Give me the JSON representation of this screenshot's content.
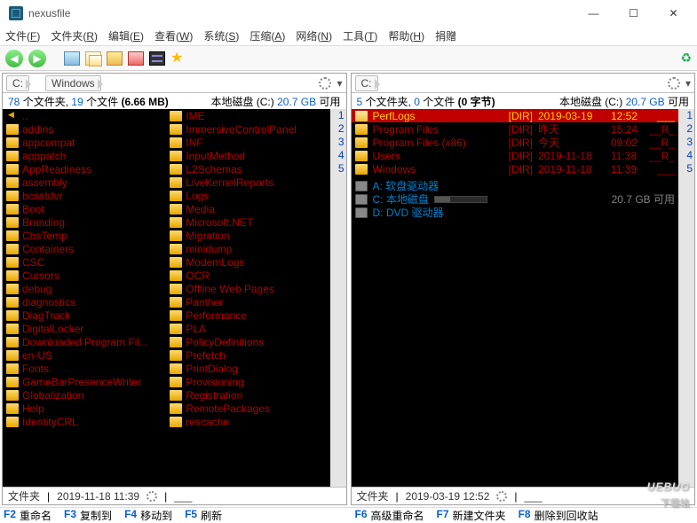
{
  "app": {
    "title": "nexusfile"
  },
  "winbtns": {
    "min": "—",
    "max": "☐",
    "close": "✕"
  },
  "menu": [
    "文件(<u>F</u>)",
    "文件夹(<u>R</u>)",
    "编辑(<u>E</u>)",
    "查看(<u>W</u>)",
    "系统(<u>S</u>)",
    "压缩(<u>A</u>)",
    "网络(<u>N</u>)",
    "工具(<u>T</u>)",
    "帮助(<u>H</u>)",
    "捐赠"
  ],
  "left": {
    "crumbs": [
      "C:",
      "Windows"
    ],
    "summary": {
      "folders_n": "78",
      "folders_lbl": "个文件夹,",
      "files_n": "19",
      "files_lbl": "个文件",
      "size": "(6.66 MB)",
      "drive_lbl": "本地磁盘 (C:)",
      "free_n": "20.7 GB",
      "free_lbl": "可用"
    },
    "colA": [
      "..",
      "addins",
      "appcompat",
      "apppatch",
      "AppReadiness",
      "assembly",
      "bcastdvr",
      "Boot",
      "Branding",
      "CbsTemp",
      "Containers",
      "CSC",
      "Cursors",
      "debug",
      "diagnostics",
      "DiagTrack",
      "DigitalLocker",
      "Downloaded Program Fil...",
      "en-US",
      "Fonts",
      "GameBarPresenceWriter",
      "Globalization",
      "Help",
      "IdentityCRL"
    ],
    "colB": [
      "IME",
      "ImmersiveControlPanel",
      "INF",
      "InputMethod",
      "L2Schemas",
      "LiveKernelReports",
      "Logs",
      "Media",
      "Microsoft.NET",
      "Migration",
      "minidump",
      "ModemLogs",
      "OCR",
      "Offline Web Pages",
      "Panther",
      "Performance",
      "PLA",
      "PolicyDefinitions",
      "Prefetch",
      "PrintDialog",
      "Provisioning",
      "Registration",
      "RemotePackages",
      "rescache"
    ],
    "status": {
      "type": "文件夹",
      "stamp": "2019-11-18 11:39",
      "attr": "___"
    }
  },
  "right": {
    "crumbs": [
      "C:"
    ],
    "summary": {
      "folders_n": "5",
      "folders_lbl": "个文件夹,",
      "files_n": "0",
      "files_lbl": "个文件",
      "size": "(0 字节)",
      "drive_lbl": "本地磁盘 (C:)",
      "free_n": "20.7 GB",
      "free_lbl": "可用"
    },
    "rows": [
      {
        "name": "PerfLogs",
        "dir": "[DIR]",
        "date": "2019-03-19",
        "time": "12:52",
        "attr": "___",
        "sel": true
      },
      {
        "name": "Program Files",
        "dir": "[DIR]",
        "date": "昨天",
        "time": "15:24",
        "attr": "__R_"
      },
      {
        "name": "Program Files (x86)",
        "dir": "[DIR]",
        "date": "今天",
        "time": "09:02",
        "attr": "__R_"
      },
      {
        "name": "Users",
        "dir": "[DIR]",
        "date": "2019-11-18",
        "time": "11:38",
        "attr": "__R_"
      },
      {
        "name": "Windows",
        "dir": "[DIR]",
        "date": "2019-11-18",
        "time": "11:39",
        "attr": "___"
      }
    ],
    "drives": [
      {
        "label": "A: 软盘驱动器",
        "note": "",
        "bar": false
      },
      {
        "label": "C: 本地磁盘",
        "note": "20.7 GB 可用",
        "bar": true
      },
      {
        "label": "D: DVD 驱动器",
        "note": "",
        "bar": false
      }
    ],
    "status": {
      "type": "文件夹",
      "stamp": "2019-03-19 12:52",
      "attr": "___"
    }
  },
  "fnbar": {
    "left": [
      {
        "key": "F2",
        "label": "重命名"
      },
      {
        "key": "F3",
        "label": "复制到"
      },
      {
        "key": "F4",
        "label": "移动到"
      },
      {
        "key": "F5",
        "label": "刷新"
      }
    ],
    "right": [
      {
        "key": "F6",
        "label": "高级重命名"
      },
      {
        "key": "F7",
        "label": "新建文件夹"
      },
      {
        "key": "F8",
        "label": "删除到回收站"
      }
    ]
  },
  "watermark": {
    "main": "UEBUG",
    "sub": "下载站"
  }
}
